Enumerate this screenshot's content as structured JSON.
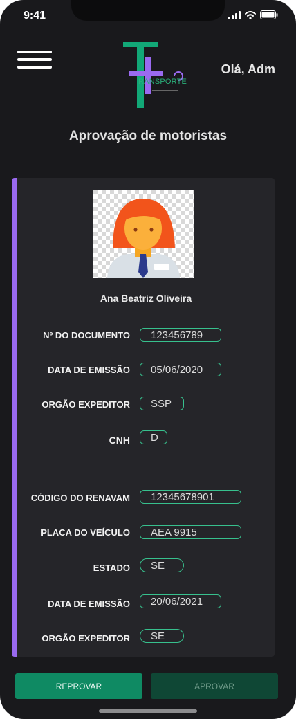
{
  "status_bar": {
    "time": "9:41"
  },
  "header": {
    "logo_text": "RANSPORTE",
    "greeting": "Olá, Adm"
  },
  "page": {
    "title": "Aprovação de motoristas"
  },
  "driver": {
    "name": "Ana Beatriz Oliveira",
    "fields": [
      {
        "label": "Nº DO DOCUMENTO",
        "value": "123456789"
      },
      {
        "label": "DATA DE EMISSÃO",
        "value": "05/06/2020"
      },
      {
        "label": "ORGÃO EXPEDITOR",
        "value": "SSP"
      },
      {
        "label": "CNH",
        "value": "D"
      },
      {
        "label": "CÓDIGO DO RENAVAM",
        "value": "12345678901"
      },
      {
        "label": "PLACA DO VEÍCULO",
        "value": "AEA 9915"
      },
      {
        "label": "ESTADO",
        "value": "SE"
      },
      {
        "label": "DATA DE EMISSÃO",
        "value": "20/06/2021"
      },
      {
        "label": "ORGÃO EXPEDITOR",
        "value": "SE"
      }
    ]
  },
  "actions": {
    "reject_label": "REPROVAR",
    "approve_label": "APROVAR"
  },
  "colors": {
    "background": "#19191c",
    "card": "#252529",
    "accent_purple": "#9a6af0",
    "accent_green": "#37c08d",
    "reject_button": "#0f8a63",
    "approve_button": "#0f4735"
  },
  "icons": [
    "signal-icon",
    "wifi-icon",
    "battery-icon",
    "menu-icon",
    "avatar-icon"
  ]
}
